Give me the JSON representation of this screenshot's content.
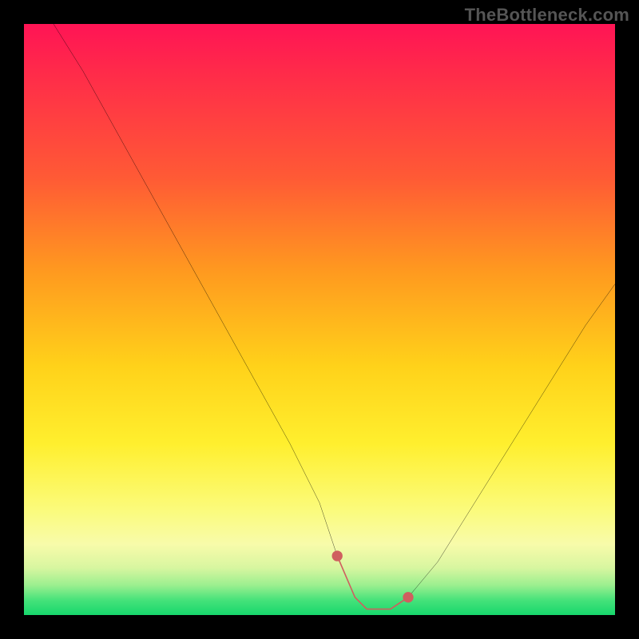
{
  "watermark": "TheBottleneck.com",
  "chart_data": {
    "type": "line",
    "title": "",
    "xlabel": "",
    "ylabel": "",
    "xlim": [
      0,
      100
    ],
    "ylim": [
      0,
      100
    ],
    "series": [
      {
        "name": "bottleneck-curve",
        "x": [
          5,
          10,
          15,
          20,
          25,
          30,
          35,
          40,
          45,
          50,
          53,
          56,
          58,
          62,
          65,
          70,
          75,
          80,
          85,
          90,
          95,
          100
        ],
        "y": [
          100,
          92,
          83,
          74,
          65,
          56,
          47,
          38,
          29,
          19,
          10,
          3,
          1,
          1,
          3,
          9,
          17,
          25,
          33,
          41,
          49,
          56
        ]
      }
    ],
    "highlight_segment": {
      "name": "optimal-zone",
      "x": [
        53,
        56,
        58,
        62,
        65
      ],
      "y": [
        10,
        3,
        1,
        1,
        3
      ],
      "color": "#cf5f5f"
    },
    "background_gradient": {
      "stops": [
        {
          "pos": 0.0,
          "color": "#ff1455"
        },
        {
          "pos": 0.26,
          "color": "#ff5a35"
        },
        {
          "pos": 0.58,
          "color": "#ffd21a"
        },
        {
          "pos": 0.88,
          "color": "#f8fbaa"
        },
        {
          "pos": 1.0,
          "color": "#17d76c"
        }
      ]
    }
  }
}
